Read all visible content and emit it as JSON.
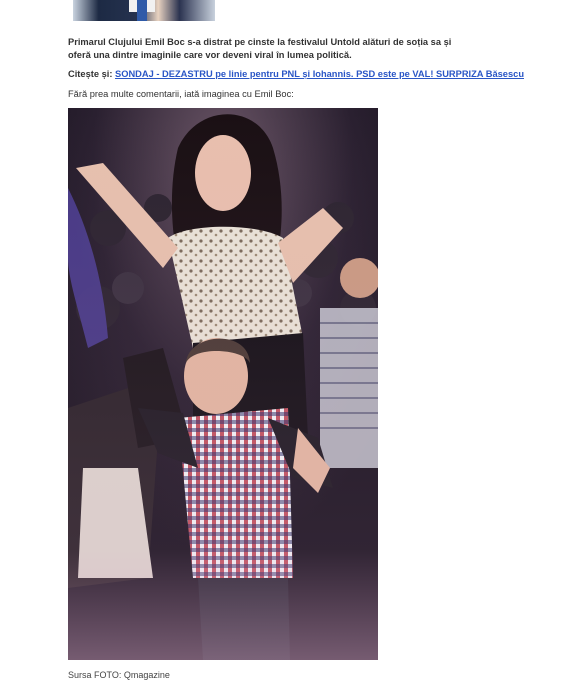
{
  "article": {
    "lead": "Primarul Clujului Emil Boc s-a distrat pe cinste la festivalul Untold alături de soția sa și oferă una dintre imaginile care vor deveni viral în lumea politică.",
    "read_also_prefix": "Citește și:",
    "read_also_link": "SONDAJ - DEZASTRU pe linie pentru PNL și Iohannis. PSD este pe VAL! SURPRIZA Băsescu",
    "intro": "Fără prea multe comentarii, iată imaginea cu Emil Boc:",
    "photo_credit": "Sursa FOTO: Qmagazine"
  }
}
